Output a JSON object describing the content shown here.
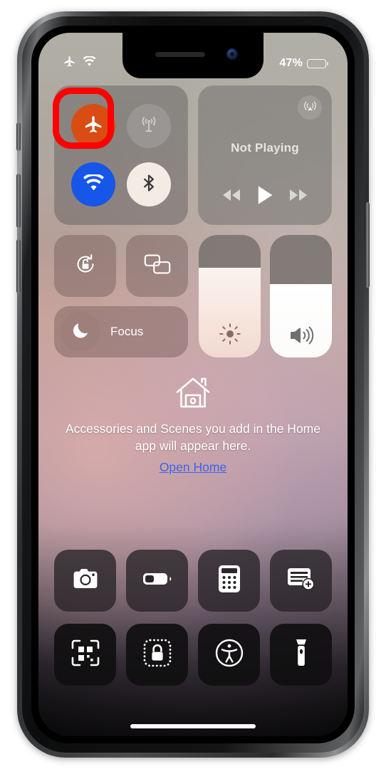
{
  "device": {
    "name": "iphone-x",
    "notch": true
  },
  "status_bar": {
    "airplane_icon": "airplane-icon",
    "wifi_icon": "wifi-icon",
    "battery_percent_label": "47%",
    "battery_level": 47,
    "battery_icon": "battery-icon"
  },
  "control_center": {
    "connectivity": {
      "airplane": {
        "label": "Airplane Mode",
        "icon": "airplane-icon",
        "state": "on",
        "color": "#d94d15",
        "highlighted": true
      },
      "cellular": {
        "label": "Cellular Data",
        "icon": "cellular-antenna-icon",
        "state": "off",
        "color": "#bebebe"
      },
      "wifi": {
        "label": "Wi-Fi",
        "icon": "wifi-icon",
        "state": "on",
        "color": "#1656e8"
      },
      "bluetooth": {
        "label": "Bluetooth",
        "icon": "bluetooth-icon",
        "state": "on",
        "color": "#f2ece4"
      }
    },
    "media": {
      "title": "Not Playing",
      "airplay_icon": "airplay-icon",
      "rewind_icon": "rewind-icon",
      "play_icon": "play-icon",
      "forward_icon": "forward-icon"
    },
    "rotation_lock": {
      "label": "Rotation Lock",
      "icon": "rotation-lock-icon",
      "state": "off"
    },
    "screen_mirroring": {
      "label": "Screen Mirroring",
      "icon": "screen-mirroring-icon"
    },
    "focus": {
      "label": "Focus",
      "icon": "moon-icon",
      "state": "off"
    },
    "brightness": {
      "label": "Brightness",
      "icon": "brightness-icon",
      "value": 73
    },
    "volume": {
      "label": "Volume",
      "icon": "volume-icon",
      "value": 60
    },
    "home": {
      "icon": "house-icon",
      "message": "Accessories and Scenes you add in the Home app will appear here.",
      "link_label": "Open Home",
      "link_color": "#3f62ea"
    },
    "shortcuts_row_1": [
      {
        "name": "camera",
        "label": "Camera",
        "icon": "camera-icon"
      },
      {
        "name": "low-power-mode",
        "label": "Low Power Mode",
        "icon": "battery-icon"
      },
      {
        "name": "calculator",
        "label": "Calculator",
        "icon": "calculator-icon"
      },
      {
        "name": "notes",
        "label": "Notes",
        "icon": "new-note-icon"
      }
    ],
    "shortcuts_row_2": [
      {
        "name": "qr-scanner",
        "label": "Code Scanner",
        "icon": "qr-code-icon"
      },
      {
        "name": "guided-access",
        "label": "Guided Access",
        "icon": "dotted-lock-icon"
      },
      {
        "name": "accessibility",
        "label": "Accessibility Shortcuts",
        "icon": "accessibility-icon"
      },
      {
        "name": "flashlight",
        "label": "Flashlight",
        "icon": "flashlight-icon"
      }
    ]
  },
  "annotation": {
    "shape": "rounded-rectangle",
    "color": "#fe0000",
    "target": "airplane-mode-button"
  }
}
